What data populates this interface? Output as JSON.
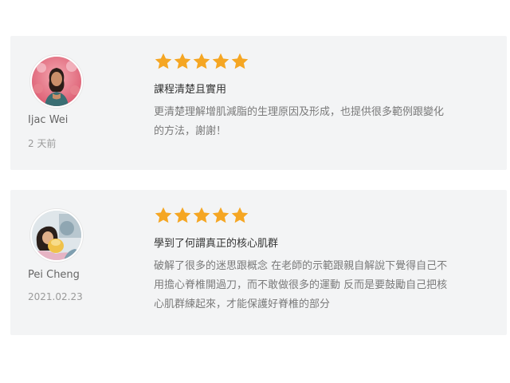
{
  "colors": {
    "card_background": "#f3f4f5",
    "star": "#f5a623",
    "title_text": "#333333",
    "body_text": "#7a7a7a",
    "name_text": "#666666",
    "date_text": "#9a9a9a"
  },
  "reviews": [
    {
      "reviewer": "Ijac Wei",
      "date": "2 天前",
      "rating": 5,
      "title": "課程清楚且實用",
      "body_lines": [
        "更清楚理解增肌減脂的生理原因及形成，也提供很多範例跟變化",
        "的方法，謝謝！"
      ],
      "avatar_icon": "user-photo-avatar"
    },
    {
      "reviewer": "Pei Cheng",
      "date": "2021.02.23",
      "rating": 5,
      "title": "學到了何謂真正的核心肌群",
      "body_lines": [
        "破解了很多的迷思跟概念 在老師的示範跟親自解說下覺得自己不",
        "用擔心脊椎開過刀，而不敢做很多的運動 反而是要鼓勵自己把核",
        "心肌群練起來，才能保護好脊椎的部分"
      ],
      "avatar_icon": "user-photo-avatar"
    }
  ]
}
